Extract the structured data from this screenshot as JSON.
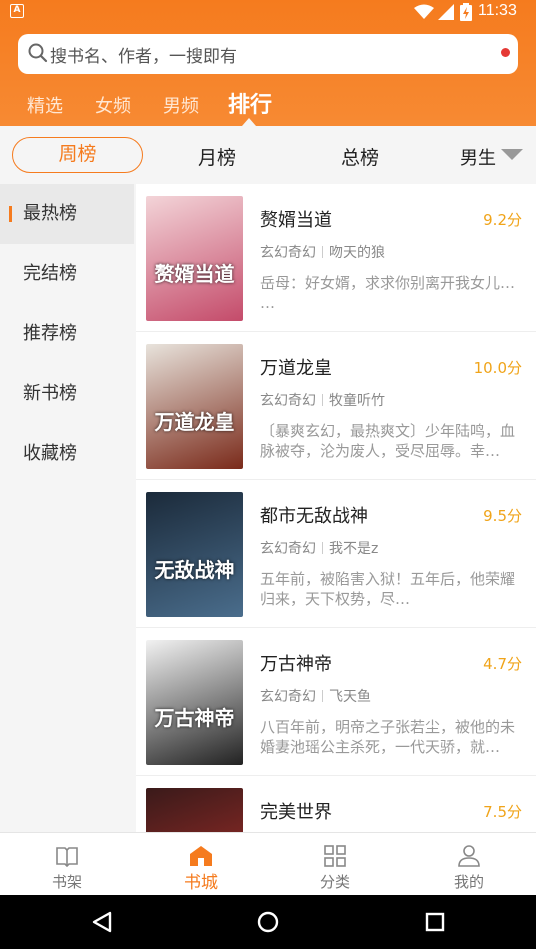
{
  "status_bar": {
    "time": "11:33",
    "app_badge": "A"
  },
  "search": {
    "placeholder": "搜书名、作者，一搜即有"
  },
  "top_tabs": [
    "精选",
    "女频",
    "男频",
    "排行"
  ],
  "rank_tabs": [
    "周榜",
    "月榜",
    "总榜"
  ],
  "gender_filter": "男生",
  "side_menu": [
    "最热榜",
    "完结榜",
    "推荐榜",
    "新书榜",
    "收藏榜"
  ],
  "books": [
    {
      "title": "赘婿当道",
      "score": "9.2分",
      "genre": "玄幻奇幻",
      "author": "吻天的狼",
      "desc": "岳母：好女婿，求求你别离开我女儿… …",
      "cover_text": "赘婿当道",
      "cover_colors": [
        "#f3d4d8",
        "#c44b6a"
      ]
    },
    {
      "title": "万道龙皇",
      "score": "10.0分",
      "genre": "玄幻奇幻",
      "author": "牧童听竹",
      "desc": "〔暴爽玄幻，最热爽文〕少年陆鸣，血脉被夺，沦为废人，受尽屈辱。幸…",
      "cover_text": "万道龙皇",
      "cover_colors": [
        "#e8e3dc",
        "#7a2a1a"
      ]
    },
    {
      "title": "都市无敌战神",
      "score": "9.5分",
      "genre": "玄幻奇幻",
      "author": "我不是z",
      "desc": "五年前，被陷害入狱！五年后，他荣耀归来，天下权势，尽…",
      "cover_text": "无敌战神",
      "cover_colors": [
        "#1b2a3a",
        "#4a6d8c"
      ]
    },
    {
      "title": "万古神帝",
      "score": "4.7分",
      "genre": "玄幻奇幻",
      "author": "飞天鱼",
      "desc": "八百年前，明帝之子张若尘，被他的未婚妻池瑶公主杀死，一代天骄，就…",
      "cover_text": "万古神帝",
      "cover_colors": [
        "#f2f2f2",
        "#222222"
      ]
    },
    {
      "title": "完美世界",
      "score": "7.5分",
      "genre": "",
      "author": "",
      "desc": "",
      "cover_text": "",
      "cover_colors": [
        "#3a1a1a",
        "#b0302a"
      ]
    }
  ],
  "bottom_nav": [
    "书架",
    "书城",
    "分类",
    "我的"
  ],
  "colors": {
    "accent": "#f57b1e",
    "score": "#f0a41a"
  }
}
